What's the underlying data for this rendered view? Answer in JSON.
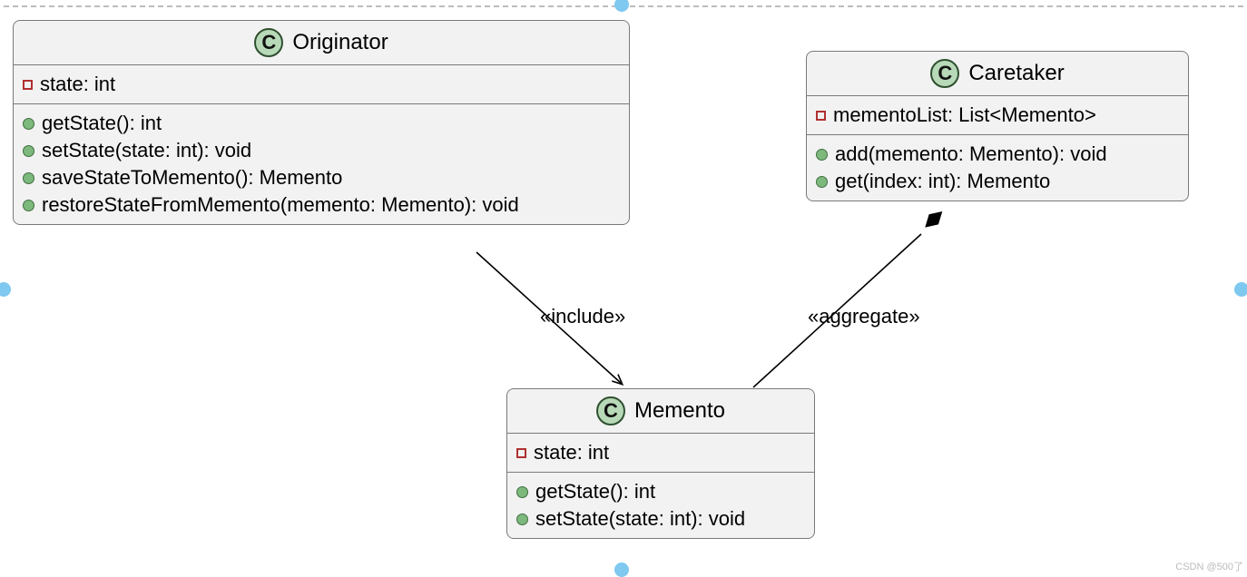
{
  "classes": {
    "originator": {
      "name": "Originator",
      "attributes": [
        {
          "vis": "protected",
          "text": "state: int"
        }
      ],
      "methods": [
        {
          "vis": "public",
          "text": "getState(): int"
        },
        {
          "vis": "public",
          "text": "setState(state: int): void"
        },
        {
          "vis": "public",
          "text": "saveStateToMemento(): Memento"
        },
        {
          "vis": "public",
          "text": "restoreStateFromMemento(memento: Memento): void"
        }
      ]
    },
    "caretaker": {
      "name": "Caretaker",
      "attributes": [
        {
          "vis": "protected",
          "text": "mementoList: List<Memento>"
        }
      ],
      "methods": [
        {
          "vis": "public",
          "text": "add(memento: Memento): void"
        },
        {
          "vis": "public",
          "text": "get(index: int): Memento"
        }
      ]
    },
    "memento": {
      "name": "Memento",
      "attributes": [
        {
          "vis": "protected",
          "text": "state: int"
        }
      ],
      "methods": [
        {
          "vis": "public",
          "text": "getState(): int"
        },
        {
          "vis": "public",
          "text": "setState(state: int): void"
        }
      ]
    }
  },
  "relationships": {
    "include": {
      "label": "«include»",
      "from": "originator",
      "to": "memento"
    },
    "aggregate": {
      "label": "«aggregate»",
      "from": "memento",
      "to": "caretaker"
    }
  },
  "watermark": "CSDN @500了"
}
